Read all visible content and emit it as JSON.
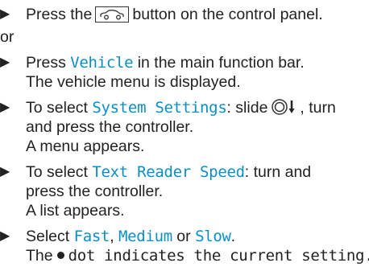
{
  "instructions": {
    "step1": {
      "before": "Press the",
      "icon": "car-icon",
      "after": "button on the control panel."
    },
    "or_text": "or",
    "step2": {
      "before": "Press",
      "highlight": "Vehicle",
      "after": "in the main function bar.",
      "result": "The vehicle menu is displayed."
    },
    "step3": {
      "before": "To select",
      "highlight": "System Settings",
      "after_a": ": slide",
      "controller_icon": "controller-slide-down-icon",
      "after_b": ", turn",
      "line2": "and press the controller.",
      "result": "A menu appears."
    },
    "step4": {
      "before": "To select",
      "highlight": "Text Reader Speed",
      "after": ": turn and",
      "line2": "press the controller.",
      "result": "A list appears."
    },
    "step5": {
      "before": "Select",
      "option1": "Fast",
      "sep1": ",",
      "option2": "Medium",
      "sep2": "or",
      "option3": "Slow",
      "end": ".",
      "result_before": "The",
      "dot_icon": "dot-icon",
      "result_after": "dot indicates the current setting."
    }
  },
  "colors": {
    "text": "#222222",
    "highlight": "#0a8fc4"
  }
}
